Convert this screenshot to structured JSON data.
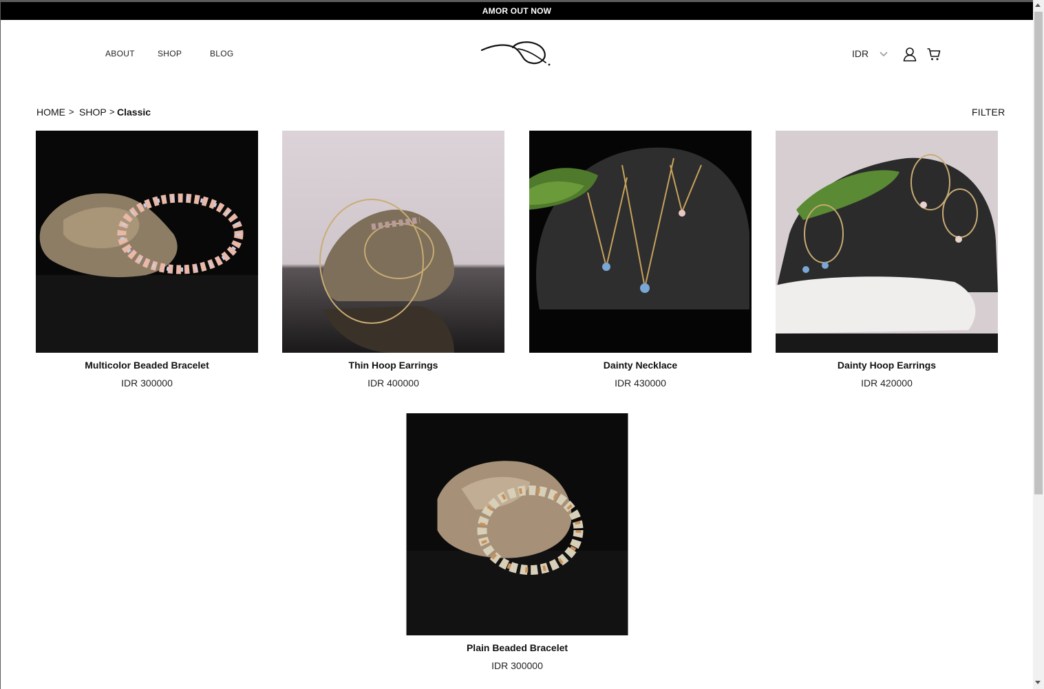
{
  "announcement": {
    "text": "AMOR OUT NOW"
  },
  "nav": {
    "items": [
      {
        "label": "ABOUT"
      },
      {
        "label": "SHOP"
      },
      {
        "label": "BLOG"
      }
    ]
  },
  "header": {
    "currency": "IDR"
  },
  "breadcrumb": {
    "home": "HOME",
    "shop": "SHOP",
    "current": "Classic",
    "separator": ">"
  },
  "toolbar": {
    "filter_label": "FILTER"
  },
  "products": [
    {
      "name": "Multicolor Beaded Bracelet",
      "price": "IDR 300000"
    },
    {
      "name": "Thin Hoop Earrings",
      "price": "IDR 400000"
    },
    {
      "name": "Dainty Necklace",
      "price": "IDR 430000"
    },
    {
      "name": "Dainty Hoop Earrings",
      "price": "IDR 420000"
    },
    {
      "name": "Plain Beaded Bracelet",
      "price": "IDR 300000"
    }
  ],
  "icons": {
    "logo": "leaf-logo-icon",
    "currency_dropdown": "chevron-down-icon",
    "account": "user-icon",
    "cart": "cart-icon"
  },
  "colors": {
    "announcement_bg": "#000000",
    "page_bg": "#ffffff",
    "text": "#111111"
  }
}
